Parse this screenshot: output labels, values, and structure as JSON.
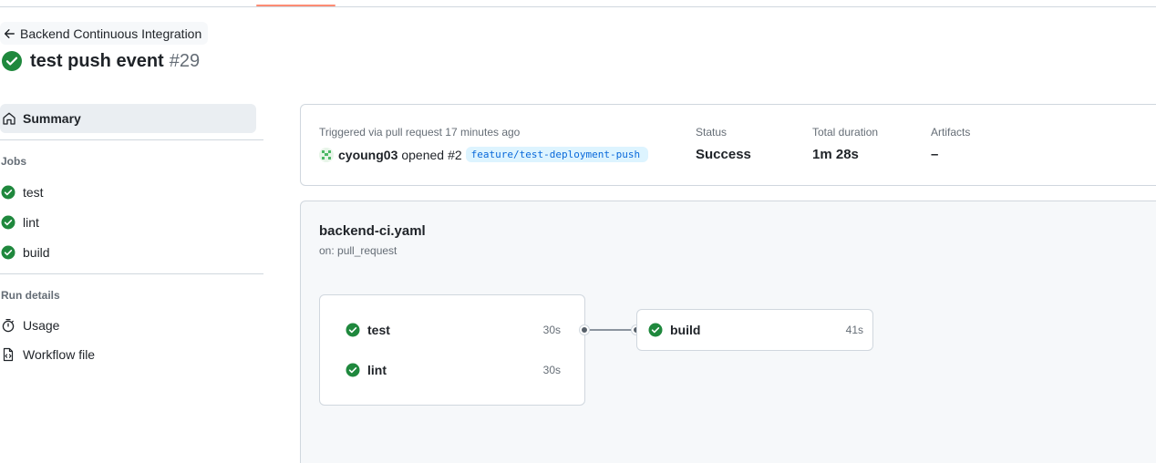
{
  "back_link": {
    "label": "Backend Continuous Integration"
  },
  "run": {
    "title": "test push event",
    "number": "#29",
    "status_color": "#1f883d"
  },
  "sidebar": {
    "summary_label": "Summary",
    "jobs_heading": "Jobs",
    "jobs": [
      {
        "label": "test",
        "status": "success"
      },
      {
        "label": "lint",
        "status": "success"
      },
      {
        "label": "build",
        "status": "success"
      }
    ],
    "run_details_heading": "Run details",
    "run_details": [
      {
        "label": "Usage",
        "icon": "stopwatch-icon"
      },
      {
        "label": "Workflow file",
        "icon": "file-code-icon"
      }
    ]
  },
  "summary": {
    "trigger_text": "Triggered via pull request 17 minutes ago",
    "user": "cyoung03",
    "action": "opened",
    "pr_number": "#2",
    "branch": "feature/test-deployment-push",
    "status_label": "Status",
    "status_value": "Success",
    "duration_label": "Total duration",
    "duration_value": "1m 28s",
    "artifacts_label": "Artifacts",
    "artifacts_value": "–"
  },
  "workflow": {
    "file": "backend-ci.yaml",
    "trigger": "on: pull_request",
    "group_jobs": [
      {
        "name": "test",
        "duration": "30s"
      },
      {
        "name": "lint",
        "duration": "30s"
      }
    ],
    "downstream_job": {
      "name": "build",
      "duration": "41s"
    }
  },
  "colors": {
    "accent_underline": "#fd8c73",
    "success": "#1f883d",
    "branch_bg": "#ddf4ff",
    "branch_fg": "#0969da"
  }
}
